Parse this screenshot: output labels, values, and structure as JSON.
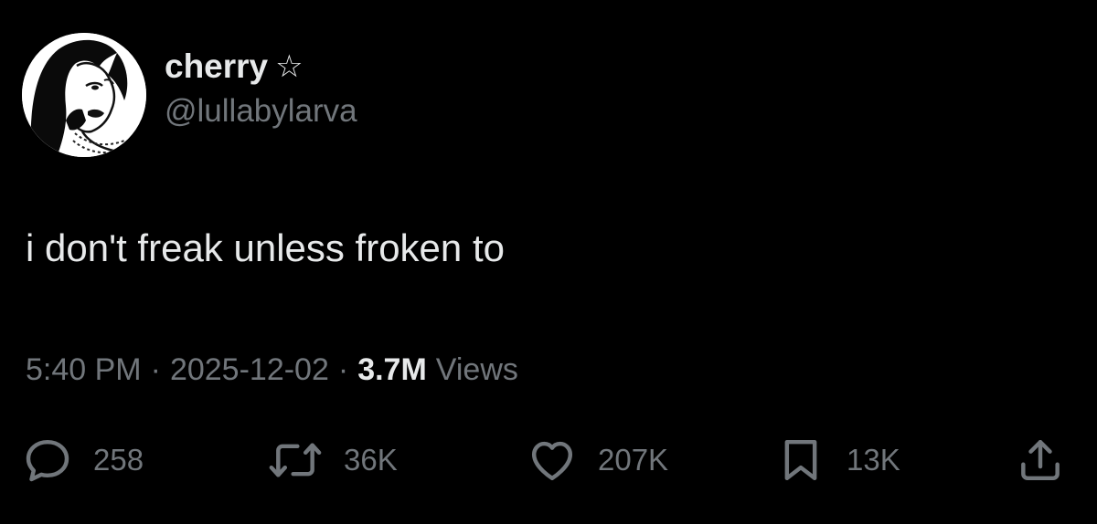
{
  "user": {
    "display_name": "cherry",
    "badge_icon": "star-outline-icon",
    "badge_glyph": "☆",
    "handle": "@lullabylarva"
  },
  "tweet": {
    "text": "i don't freak unless froken to"
  },
  "meta": {
    "time": "5:40 PM",
    "separator": "·",
    "date": "2025-12-02",
    "views_count": "3.7M",
    "views_label": "Views"
  },
  "actions": {
    "replies": "258",
    "retweets": "36K",
    "likes": "207K",
    "bookmarks": "13K"
  },
  "colors": {
    "background": "#000000",
    "primary_text": "#e7e9ea",
    "secondary_text": "#71767b"
  }
}
